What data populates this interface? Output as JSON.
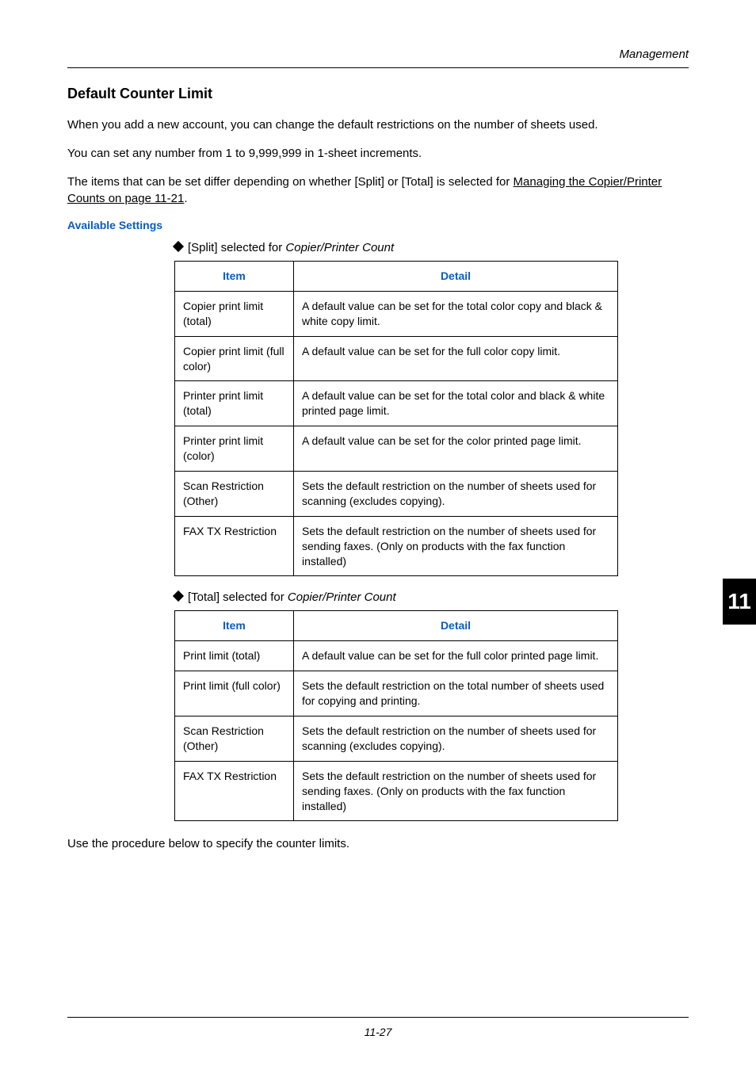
{
  "header": {
    "running": "Management"
  },
  "sidetab": {
    "label": "11"
  },
  "section": {
    "title": "Default Counter Limit",
    "p1": "When you add a new account, you can change the default restrictions on the number of sheets used.",
    "p2": "You can set any number from 1 to 9,999,999 in 1-sheet increments.",
    "p3a": "The items that can be set differ depending on whether [Split] or [Total] is selected for ",
    "p3_link": "Managing the Copier/Printer Counts on page 11-21",
    "p3b": "."
  },
  "available": {
    "heading": "Available Settings",
    "bullet1_pre": "[Split] selected for ",
    "bullet1_em": "Copier/Printer Count",
    "bullet2_pre": "[Total] selected for ",
    "bullet2_em": "Copier/Printer Count"
  },
  "table_headers": {
    "item": "Item",
    "detail": "Detail"
  },
  "table_split": [
    {
      "item": "Copier print limit (total)",
      "detail": "A default value can be set for the total color copy and black & white copy limit."
    },
    {
      "item": "Copier print limit (full color)",
      "detail": "A default value can be set for the full color copy limit."
    },
    {
      "item": "Printer print limit (total)",
      "detail": "A default value can be set for the total color and black & white printed page limit."
    },
    {
      "item": "Printer print limit (color)",
      "detail": "A default value can be set for the color printed page limit."
    },
    {
      "item": "Scan Restriction (Other)",
      "detail": "Sets the default restriction on the number of sheets used for scanning (excludes copying)."
    },
    {
      "item": "FAX TX Restriction",
      "detail": "Sets the default restriction on the number of sheets used for sending faxes. (Only on products with the fax function installed)"
    }
  ],
  "table_total": [
    {
      "item": "Print limit (total)",
      "detail": "A default value can be set for the full color printed page limit."
    },
    {
      "item": "Print limit (full color)",
      "detail": "Sets the default restriction on the total number of sheets used for copying and printing."
    },
    {
      "item": "Scan Restriction (Other)",
      "detail": "Sets the default restriction on the number of sheets used for scanning (excludes copying)."
    },
    {
      "item": "FAX TX Restriction",
      "detail": "Sets the default restriction on the number of sheets used for sending faxes. (Only on products with the fax function installed)"
    }
  ],
  "closing": {
    "p": "Use the procedure below to specify the counter limits."
  },
  "footer": {
    "page": "11-27"
  }
}
